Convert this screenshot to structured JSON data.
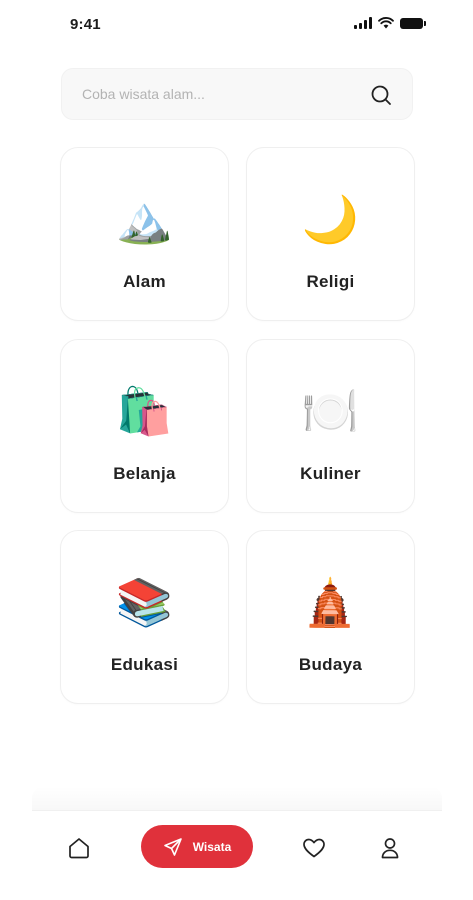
{
  "status_bar": {
    "time": "9:41"
  },
  "search": {
    "placeholder": "Coba wisata alam..."
  },
  "categories": [
    {
      "label": "Alam",
      "emoji": "🏔️",
      "icon": "mountain-icon"
    },
    {
      "label": "Religi",
      "emoji": "🌙",
      "icon": "crescent-moon-star-icon"
    },
    {
      "label": "Belanja",
      "emoji": "🛍️",
      "icon": "shopping-bags-icon"
    },
    {
      "label": "Kuliner",
      "emoji": "🍽️",
      "icon": "plate-cutlery-icon"
    },
    {
      "label": "Edukasi",
      "emoji": "📚",
      "icon": "books-icon"
    },
    {
      "label": "Budaya",
      "emoji": "🛕",
      "icon": "temple-icon"
    }
  ],
  "bottom_nav": {
    "items": [
      {
        "name": "home",
        "icon": "home-icon"
      },
      {
        "name": "wisata",
        "icon": "send-icon",
        "label": "Wisata",
        "active": true
      },
      {
        "name": "favorites",
        "icon": "heart-icon"
      },
      {
        "name": "profile",
        "icon": "user-icon"
      }
    ]
  },
  "colors": {
    "accent": "#e0313b",
    "text": "#222222",
    "placeholder": "#b3b3b3",
    "card_border": "#efefef"
  }
}
